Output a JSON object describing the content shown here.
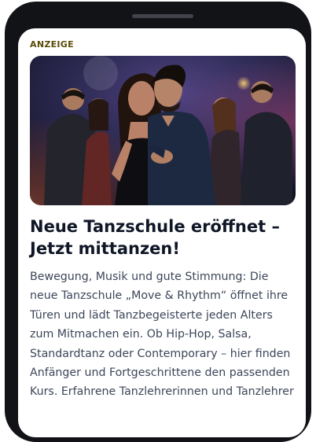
{
  "ad": {
    "badge": "ANZEIGE",
    "image_icon": "dance-couple-photo",
    "headline": "Neue Tanzschule eröffnet – Jetzt mittanzen!",
    "body": "Bewegung, Musik und gute Stimmung: Die neue Tanzschule „Move & Rhythm“ öffnet ihre Türen und lädt Tanzbegeisterte jeden Alters zum Mitmachen ein. Ob Hip-Hop, Salsa, Standardtanz oder Contemporary – hier finden Anfänger und Fortgeschrittene den passenden Kurs. Erfahrene Tanzlehrerinnen und Tanzlehrer"
  },
  "colors": {
    "frame": "#111317",
    "badge": "#5c4a06",
    "headline": "#0f1626",
    "body": "#3c4659"
  }
}
